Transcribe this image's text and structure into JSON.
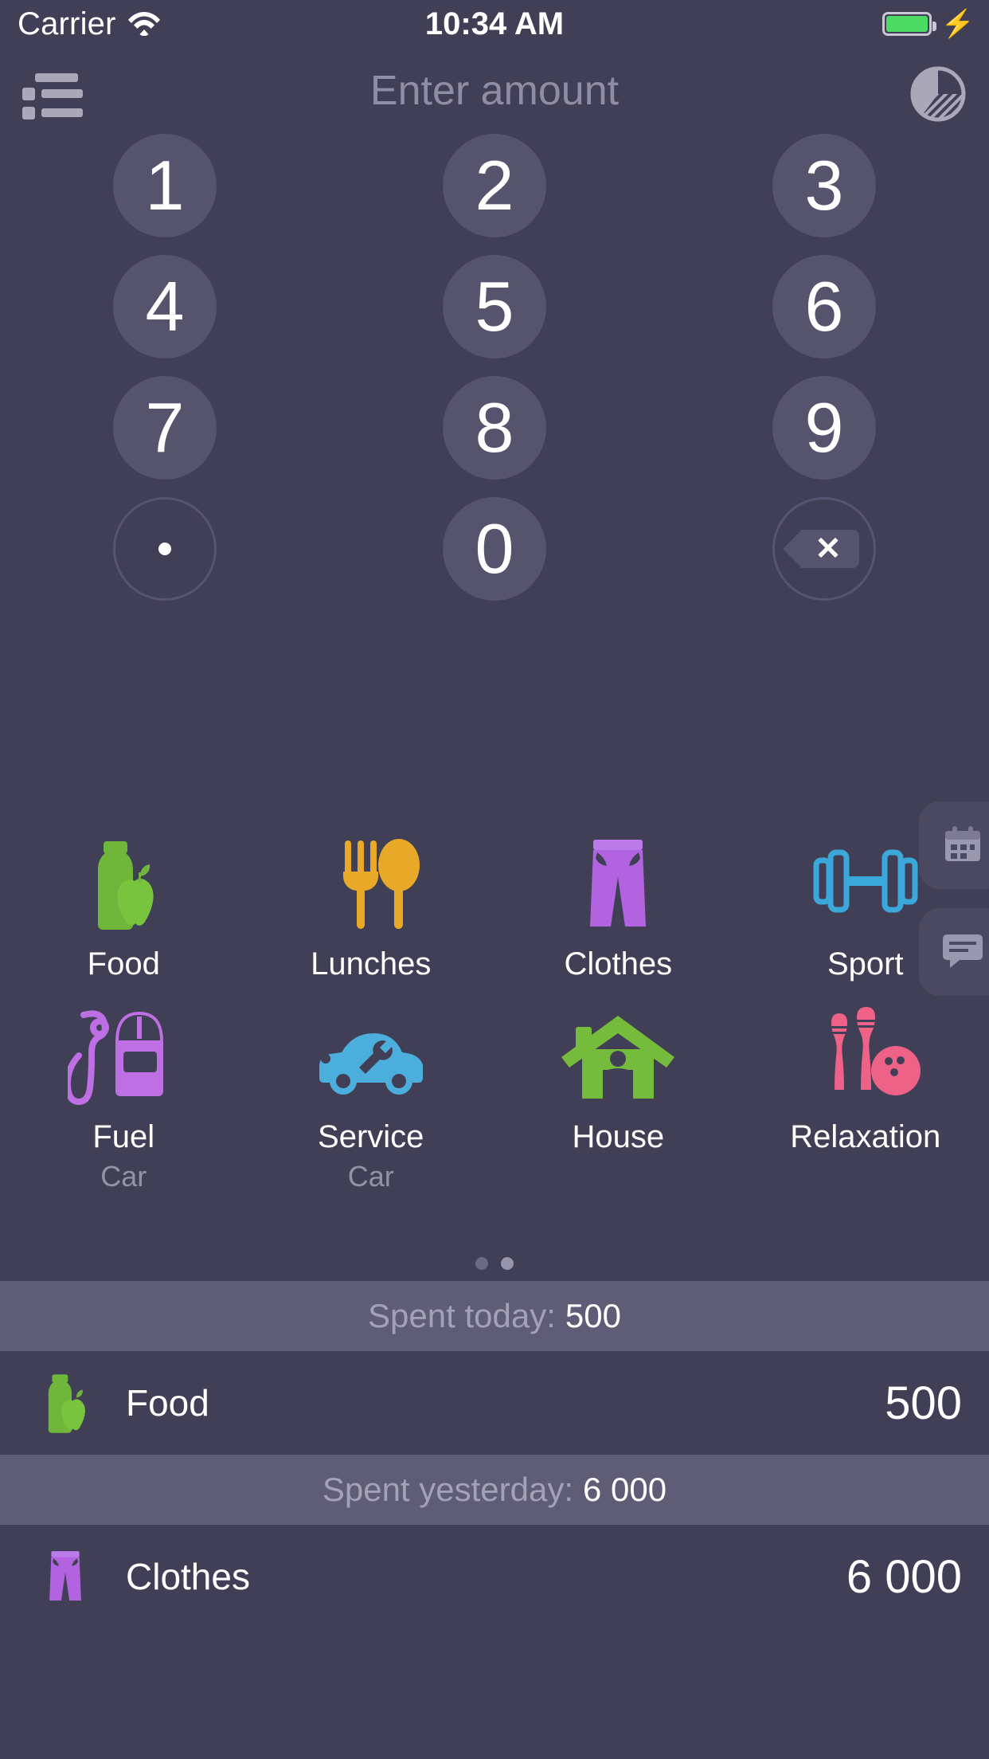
{
  "status_bar": {
    "carrier": "Carrier",
    "wifi_icon": "wifi-icon",
    "time": "10:34 AM",
    "battery_icon": "battery-icon",
    "charging_icon": "lightning-bolt-icon",
    "battery_color": "#4CD964"
  },
  "nav": {
    "title": "Enter amount",
    "left_icon": "list-icon",
    "right_icon": "pie-chart-icon"
  },
  "keypad": {
    "keys": [
      "1",
      "2",
      "3",
      "4",
      "5",
      "6",
      "7",
      "8",
      "9"
    ],
    "decimal": ".",
    "zero": "0",
    "delete_icon": "backspace-icon"
  },
  "side_buttons": [
    {
      "name": "calendar-button",
      "icon": "calendar-icon"
    },
    {
      "name": "note-button",
      "icon": "comment-icon"
    }
  ],
  "categories": [
    {
      "label": "Food",
      "sub": "",
      "icon": "bottle-apple-icon",
      "color": "#6FB63B"
    },
    {
      "label": "Lunches",
      "sub": "",
      "icon": "fork-spoon-icon",
      "color": "#E8A928"
    },
    {
      "label": "Clothes",
      "sub": "",
      "icon": "pants-icon",
      "color": "#B163E0"
    },
    {
      "label": "Sport",
      "sub": "",
      "icon": "dumbbell-icon",
      "color": "#3BA8DA"
    },
    {
      "label": "Fuel",
      "sub": "Car",
      "icon": "fuel-pump-icon",
      "color": "#BD6FE3"
    },
    {
      "label": "Service",
      "sub": "Car",
      "icon": "car-wrench-icon",
      "color": "#4CAEDC"
    },
    {
      "label": "House",
      "sub": "",
      "icon": "house-icon",
      "color": "#76BC3C"
    },
    {
      "label": "Relaxation",
      "sub": "",
      "icon": "bowling-icon",
      "color": "#EE6287"
    }
  ],
  "pager": {
    "total": 2,
    "active_index": 1
  },
  "summary": [
    {
      "header_label": "Spent today:",
      "header_value": "500",
      "rows": [
        {
          "icon": "bottle-apple-icon",
          "color": "#6FB63B",
          "name": "Food",
          "amount": "500"
        }
      ]
    },
    {
      "header_label": "Spent yesterday:",
      "header_value": "6 000",
      "rows": [
        {
          "icon": "pants-icon",
          "color": "#B163E0",
          "name": "Clothes",
          "amount": "6 000"
        }
      ]
    }
  ]
}
